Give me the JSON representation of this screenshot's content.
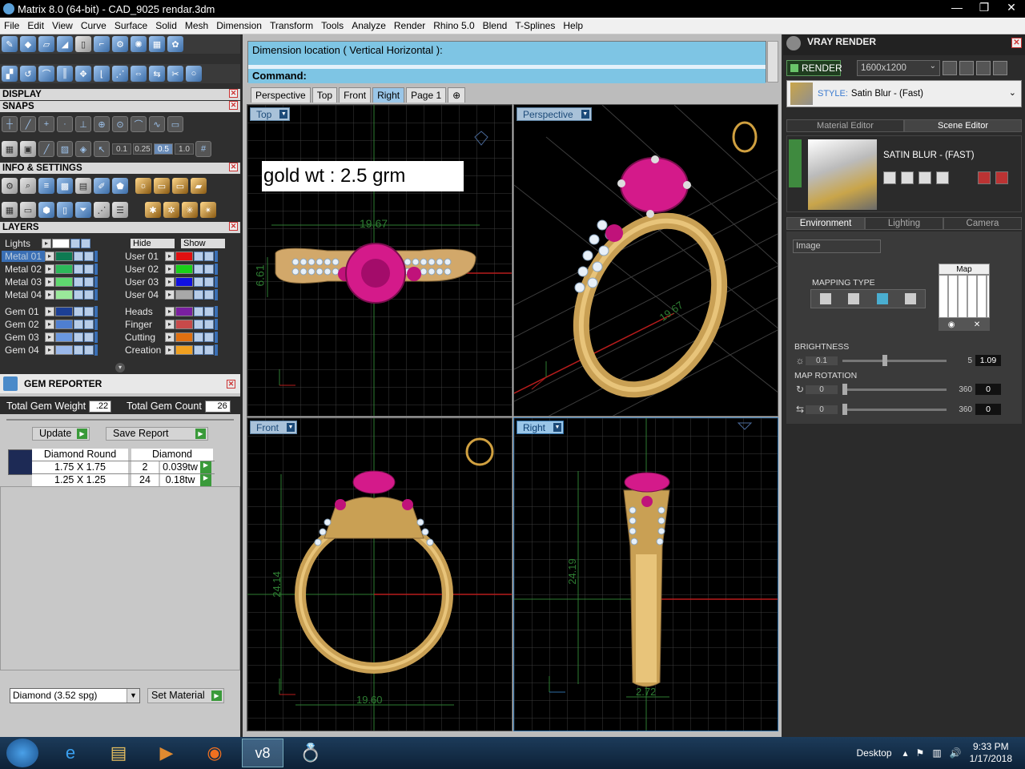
{
  "window": {
    "title": "Matrix 8.0 (64-bit) - CAD_9025 rendar.3dm",
    "controls": [
      "—",
      "❐",
      "✕"
    ]
  },
  "menu": [
    "File",
    "Edit",
    "View",
    "Curve",
    "Surface",
    "Solid",
    "Mesh",
    "Dimension",
    "Transform",
    "Tools",
    "Analyze",
    "Render",
    "Rhino 5.0",
    "Blend",
    "T-Splines",
    "Help"
  ],
  "left": {
    "sections": {
      "display": "DISPLAY",
      "snaps": "SNAPS",
      "info": "INFO & SETTINGS",
      "layers": "LAYERS"
    },
    "snap_values": [
      "0.1",
      "0.25",
      "0.5",
      "1.0"
    ],
    "layers": {
      "lights": "Lights",
      "hide": "Hide",
      "show": "Show",
      "left_col": [
        {
          "name": "Metal 01",
          "color": "#0e7a52",
          "selected": true
        },
        {
          "name": "Metal 02",
          "color": "#2db85a"
        },
        {
          "name": "Metal 03",
          "color": "#5fd86f"
        },
        {
          "name": "Metal 04",
          "color": "#9ae89a"
        },
        {
          "name": "Gem 01",
          "color": "#1c3f95"
        },
        {
          "name": "Gem 02",
          "color": "#4f7fd1"
        },
        {
          "name": "Gem 03",
          "color": "#6a98e0"
        },
        {
          "name": "Gem 04",
          "color": "#9ab8ea"
        }
      ],
      "right_col": [
        {
          "name": "User 01",
          "color": "#e01010"
        },
        {
          "name": "User 02",
          "color": "#19d019"
        },
        {
          "name": "User 03",
          "color": "#1010e0"
        },
        {
          "name": "User 04",
          "color": "#a8a8a8"
        },
        {
          "name": "Heads",
          "color": "#7a1fa0"
        },
        {
          "name": "Finger",
          "color": "#c84a4a"
        },
        {
          "name": "Cutting",
          "color": "#e07010"
        },
        {
          "name": "Creation",
          "color": "#f0a020"
        }
      ]
    },
    "gem_reporter": {
      "title": "GEM REPORTER",
      "total_weight_label": "Total Gem Weight",
      "total_weight": ".22",
      "total_count_label": "Total Gem Count",
      "total_count": "26",
      "update": "Update",
      "save_report": "Save Report",
      "table_head": [
        "Diamond Round",
        "Diamond"
      ],
      "rows": [
        {
          "size": "1.75 X 1.75",
          "count": "2",
          "wt": "0.039tw"
        },
        {
          "size": "1.25 X 1.25",
          "count": "24",
          "wt": "0.18tw"
        }
      ],
      "material": "Diamond    (3.52 spg)",
      "set_material": "Set Material"
    }
  },
  "center": {
    "cmd_line1": "Dimension location ( Vertical  Horizontal ):",
    "cmd_line2": "Command:",
    "tabs": [
      {
        "label": "Perspective",
        "selected": false
      },
      {
        "label": "Top",
        "selected": false
      },
      {
        "label": "Front",
        "selected": false
      },
      {
        "label": "Right",
        "selected": true
      },
      {
        "label": "Page 1",
        "selected": false
      }
    ],
    "add_tab": "⊕",
    "viewports": {
      "top": "Top",
      "perspective": "Perspective",
      "front": "Front",
      "right": "Right"
    },
    "gold_wt": "gold wt : 2.5 grm",
    "dims": {
      "top_w": "19.67",
      "top_h": "6.61",
      "front_w": "19.60",
      "front_h": "24.14",
      "right_w": "2.72",
      "right_h": "24.19",
      "persp": "19.67"
    }
  },
  "right": {
    "title": "VRAY RENDER",
    "render": "RENDER",
    "resolution": "1600x1200",
    "style_label": "STYLE:",
    "style_value": "Satin Blur - (Fast)",
    "editor_tabs": [
      {
        "label": "Material Editor",
        "selected": false
      },
      {
        "label": "Scene Editor",
        "selected": true
      }
    ],
    "scene_name": "SATIN BLUR - (FAST)",
    "env_tabs": [
      {
        "label": "Environment",
        "selected": true
      },
      {
        "label": "Lighting",
        "selected": false
      },
      {
        "label": "Camera",
        "selected": false
      }
    ],
    "image_select": "Image",
    "map_label": "Map",
    "mapping_type": "MAPPING TYPE",
    "brightness": {
      "label": "BRIGHTNESS",
      "min": "0.1",
      "max": "5",
      "value": "1.09"
    },
    "map_rotation": {
      "label": "MAP ROTATION",
      "min": "0",
      "max": "360",
      "value1": "0",
      "value2": "0"
    }
  },
  "taskbar": {
    "desktop": "Desktop",
    "time": "9:33 PM",
    "date": "1/17/2018",
    "apps": [
      "e",
      "▤",
      "▶",
      "◉",
      "v8",
      "💍"
    ]
  }
}
